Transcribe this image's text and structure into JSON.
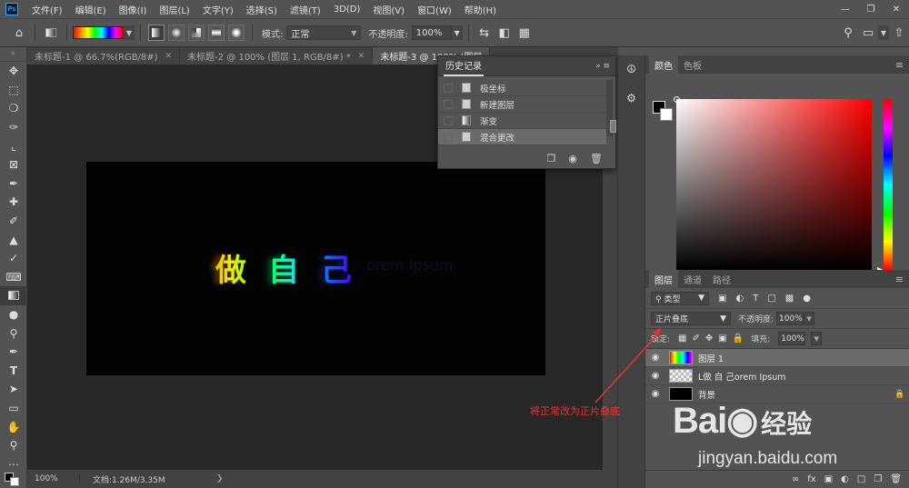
{
  "app": {
    "logo": "Ps"
  },
  "menu": [
    "文件(F)",
    "编辑(E)",
    "图像(I)",
    "图层(L)",
    "文字(Y)",
    "选择(S)",
    "滤镜(T)",
    "3D(D)",
    "视图(V)",
    "窗口(W)",
    "帮助(H)"
  ],
  "options": {
    "mode_label": "模式:",
    "mode_value": "正常",
    "opacity_label": "不透明度:",
    "opacity_value": "100%"
  },
  "tabs": [
    {
      "label": "未标题-1 @ 66.7%(RGB/8#)",
      "active": false
    },
    {
      "label": "未标题-2 @ 100% (图层 1, RGB/8#) *",
      "active": false
    },
    {
      "label": "未标题-3 @ 100% (图层",
      "active": true
    }
  ],
  "canvas": {
    "chars": [
      "做",
      "自",
      "己"
    ],
    "faded_text": "orem Ipsum"
  },
  "status": {
    "zoom": "100%",
    "doc": "文档:1.26M/3.35M"
  },
  "history": {
    "title": "历史记录",
    "items": [
      "极坐标",
      "新建图层",
      "渐变",
      "混合更改"
    ],
    "selected_index": 3
  },
  "color_panel": {
    "tabs": [
      "颜色",
      "色板"
    ]
  },
  "layers_panel": {
    "tabs": [
      "图层",
      "通道",
      "路径"
    ],
    "kind": "类型",
    "blend_mode": "正片叠底",
    "opacity_label": "不透明度:",
    "opacity_value": "100%",
    "lock_label": "锁定:",
    "fill_label": "填充:",
    "fill_value": "100%",
    "layers": [
      {
        "name": "图层 1",
        "selected": true
      },
      {
        "name": "L做 自 己orem Ipsum",
        "selected": false
      },
      {
        "name": "背景",
        "selected": false
      }
    ]
  },
  "annotation": "将正常改为正片叠底",
  "watermark": {
    "logo": "Bai",
    "cn": "经验",
    "url": "jingyan.baidu.com"
  }
}
